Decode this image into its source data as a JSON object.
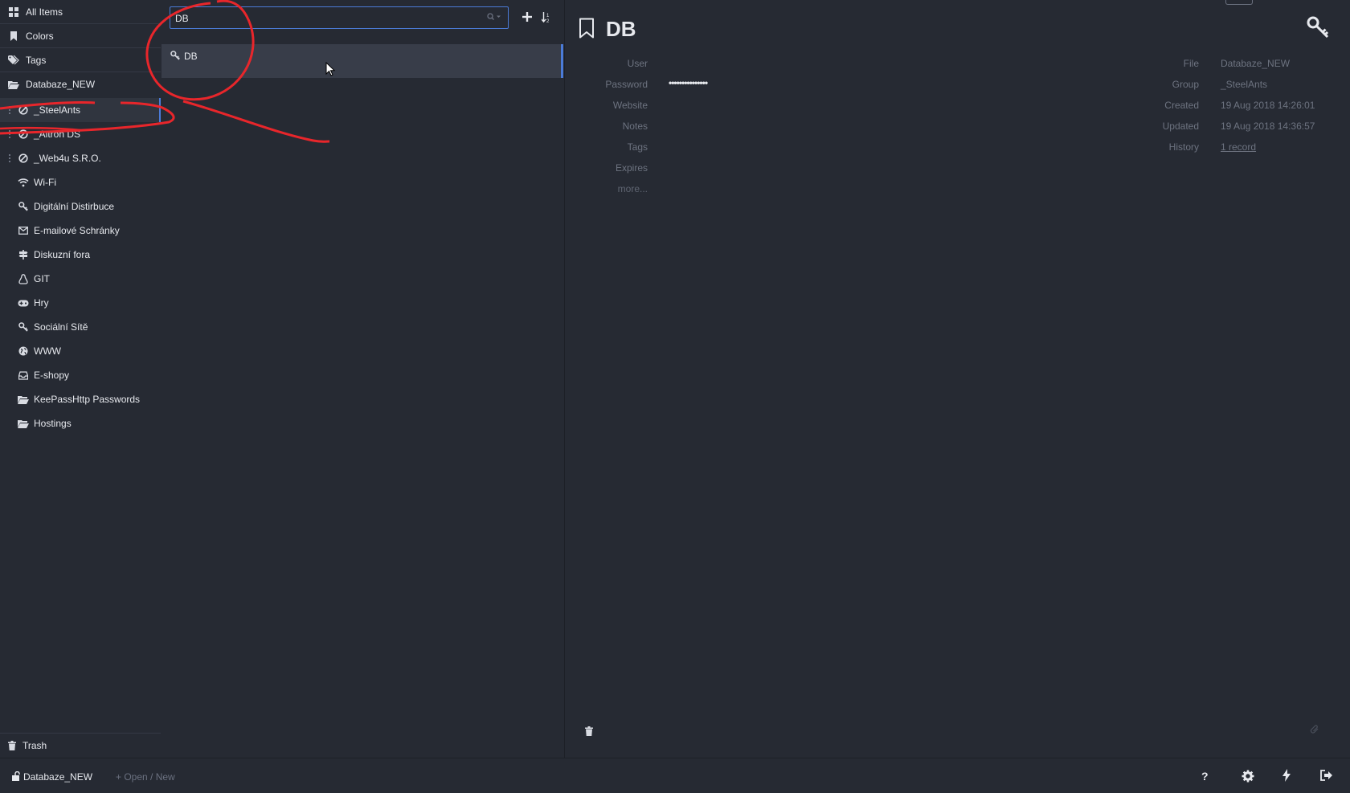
{
  "sidebar": {
    "items": [
      {
        "label": "All Items",
        "icon": "grid-icon"
      },
      {
        "label": "Colors",
        "icon": "bookmark-icon"
      },
      {
        "label": "Tags",
        "icon": "tags-icon"
      },
      {
        "label": "Databaze_NEW",
        "icon": "folder-open-icon"
      }
    ],
    "groups": [
      {
        "label": "_SteelAnts",
        "icon": "ban-icon"
      },
      {
        "label": "_Altron DS",
        "icon": "ban-icon"
      },
      {
        "label": "_Web4u S.R.O.",
        "icon": "ban-icon"
      },
      {
        "label": "Wi-Fi",
        "icon": "wifi-icon"
      },
      {
        "label": "Digitální Distirbuce",
        "icon": "key-icon"
      },
      {
        "label": "E-mailové Schránky",
        "icon": "envelope-icon"
      },
      {
        "label": "Diskuzní fora",
        "icon": "signpost-icon"
      },
      {
        "label": "GIT",
        "icon": "linux-icon"
      },
      {
        "label": "Hry",
        "icon": "gamepad-icon"
      },
      {
        "label": "Sociální Sítě",
        "icon": "key-icon"
      },
      {
        "label": "WWW",
        "icon": "globe-icon"
      },
      {
        "label": "E-shopy",
        "icon": "inbox-icon"
      },
      {
        "label": "KeePassHttp Passwords",
        "icon": "folder-open-icon"
      },
      {
        "label": "Hostings",
        "icon": "folder-open-icon"
      }
    ],
    "trash": "Trash"
  },
  "search": {
    "value": "DB"
  },
  "list": {
    "items": [
      {
        "title": "DB",
        "icon": "key-icon"
      }
    ]
  },
  "detail": {
    "title": "DB",
    "fields_left": [
      {
        "label": "User",
        "value": ""
      },
      {
        "label": "Password",
        "value": "•••••••••••••••"
      },
      {
        "label": "Website",
        "value": ""
      },
      {
        "label": "Notes",
        "value": ""
      },
      {
        "label": "Tags",
        "value": ""
      },
      {
        "label": "Expires",
        "value": ""
      }
    ],
    "more": "more...",
    "fields_right": [
      {
        "label": "File",
        "value": "Databaze_NEW"
      },
      {
        "label": "Group",
        "value": "_SteelAnts"
      },
      {
        "label": "Created",
        "value": "19 Aug 2018 14:26:01"
      },
      {
        "label": "Updated",
        "value": "19 Aug 2018 14:36:57"
      },
      {
        "label": "History",
        "value": "1 record"
      }
    ]
  },
  "footer": {
    "db_name": "Databaze_NEW",
    "open_new": "Open / New"
  },
  "colors": {
    "accent": "#4b7bd8",
    "background": "#262a33",
    "annotation": "#e8262b"
  }
}
